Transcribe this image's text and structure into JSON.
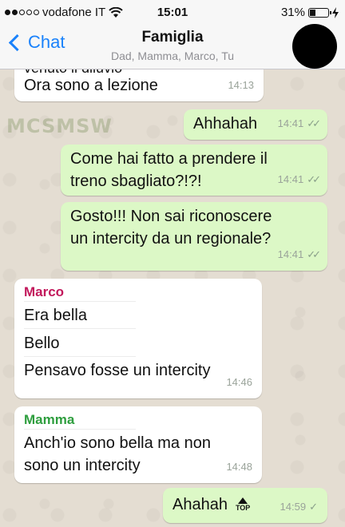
{
  "status_bar": {
    "carrier": "vodafone IT",
    "time": "15:01",
    "battery_percent": "31%",
    "battery_level": 0.31,
    "signal_bars_filled": 2,
    "signal_bars_total": 5
  },
  "nav": {
    "back_label": "Chat",
    "title": "Famiglia",
    "subtitle": "Dad, Mamma, Marco, Tu"
  },
  "watermark": "MCSMSW",
  "messages": [
    {
      "text": "Ora sono  a lezione",
      "time": "14:13",
      "partial_top": "venuto il diluvio"
    },
    {
      "text": "Ahhahah",
      "time": "14:41"
    },
    {
      "line1": "Come hai fatto a prendere il",
      "line2": "treno sbagliato?!?!",
      "time": "14:41"
    },
    {
      "line1": "Gosto!!! Non sai riconoscere",
      "line2": "un intercity da un regionale?",
      "time": "14:41"
    },
    {
      "sender": "Marco",
      "lines": [
        "Era bella",
        "Bello",
        "Pensavo fosse un intercity"
      ],
      "time": "14:46"
    },
    {
      "sender": "Mamma",
      "line1": "Anch'io sono bella ma non",
      "line2": "sono un intercity",
      "time": "14:48"
    },
    {
      "text": "Ahahah",
      "badge": "TOP",
      "time": "14:59"
    }
  ],
  "colors": {
    "accent": "#1a82fb",
    "outgoing_bubble": "#dcf8c6",
    "incoming_bubble": "#ffffff",
    "marco_name": "#c2185b",
    "mamma_name": "#2e9e3e"
  }
}
